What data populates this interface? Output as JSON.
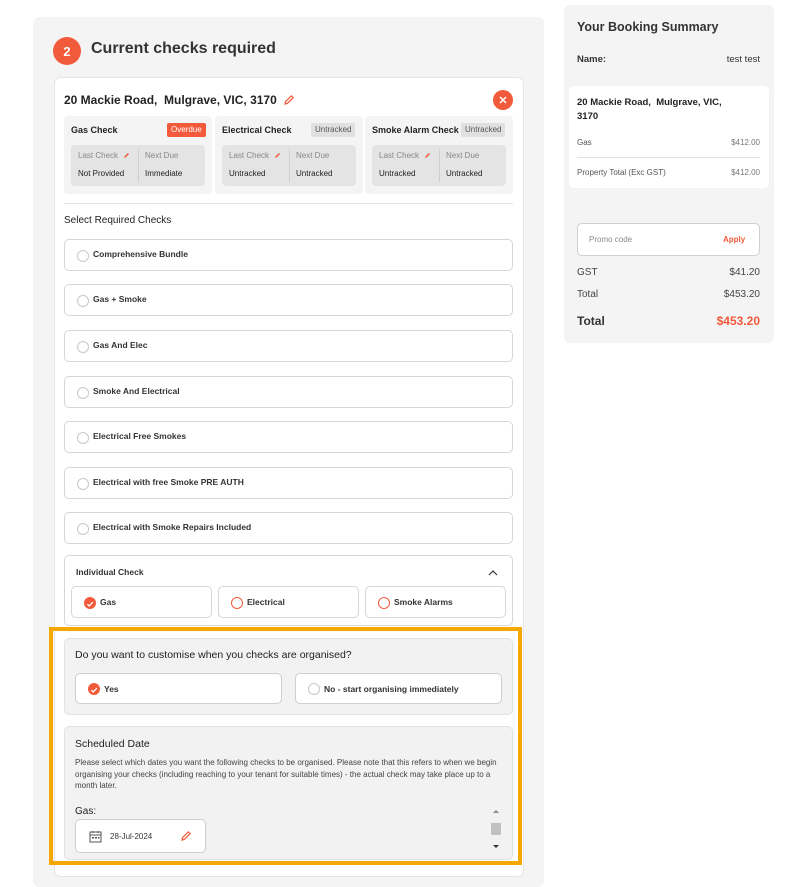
{
  "step": {
    "number": "2",
    "title": "Current checks required"
  },
  "property": {
    "address": "20 Mackie Road,  Mulgrave, VIC, 3170",
    "checks": [
      {
        "name": "Gas Check",
        "tag": "Overdue",
        "last_label": "Last Check",
        "next_label": "Next Due",
        "last_value": "Not Provided",
        "next_value": "Immediate"
      },
      {
        "name": "Electrical Check",
        "tag": "Untracked",
        "last_label": "Last Check",
        "next_label": "Next Due",
        "last_value": "Untracked",
        "next_value": "Untracked"
      },
      {
        "name": "Smoke Alarm Check",
        "tag": "Untracked",
        "last_label": "Last Check",
        "next_label": "Next Due",
        "last_value": "Untracked",
        "next_value": "Untracked"
      }
    ]
  },
  "select_required": {
    "label": "Select Required Checks",
    "options": [
      "Comprehensive Bundle",
      "Gas + Smoke",
      "Gas And Elec",
      "Smoke And Electrical",
      "Electrical Free Smokes",
      "Electrical with free Smoke PRE AUTH",
      "Electrical with Smoke Repairs Included"
    ]
  },
  "individual": {
    "title": "Individual Check",
    "options": [
      {
        "label": "Gas",
        "checked": true
      },
      {
        "label": "Electrical",
        "checked": false
      },
      {
        "label": "Smoke Alarms",
        "checked": false
      }
    ]
  },
  "customise": {
    "question": "Do you want to customise when you checks are organised?",
    "yes": "Yes",
    "no": "No - start organising immediately"
  },
  "scheduled": {
    "title": "Scheduled Date",
    "text": "Please select which dates you want the following checks to be organised. Please note that this refers to when we begin organising your checks (including reaching to your tenant for suitable times) - the actual check may take place up to a month later.",
    "gas_label": "Gas:",
    "gas_date": "28-Jul-2024"
  },
  "summary": {
    "title": "Your Booking Summary",
    "name_label": "Name:",
    "name_value": "test test",
    "address": "20 Mackie Road,  Mulgrave, VIC,\n3170",
    "gas_label": "Gas",
    "gas_value": "$412.00",
    "property_total_label": "Property Total (Exc GST)",
    "property_total_value": "$412.00",
    "promo_placeholder": "Promo code",
    "apply": "Apply",
    "gst_label": "GST",
    "gst_value": "$41.20",
    "total_label": "Total",
    "total_value": "$453.20",
    "grand_label": "Total",
    "grand_value": "$453.20"
  },
  "colors": {
    "accent": "#f15a3a",
    "highlight": "#f5a800"
  }
}
